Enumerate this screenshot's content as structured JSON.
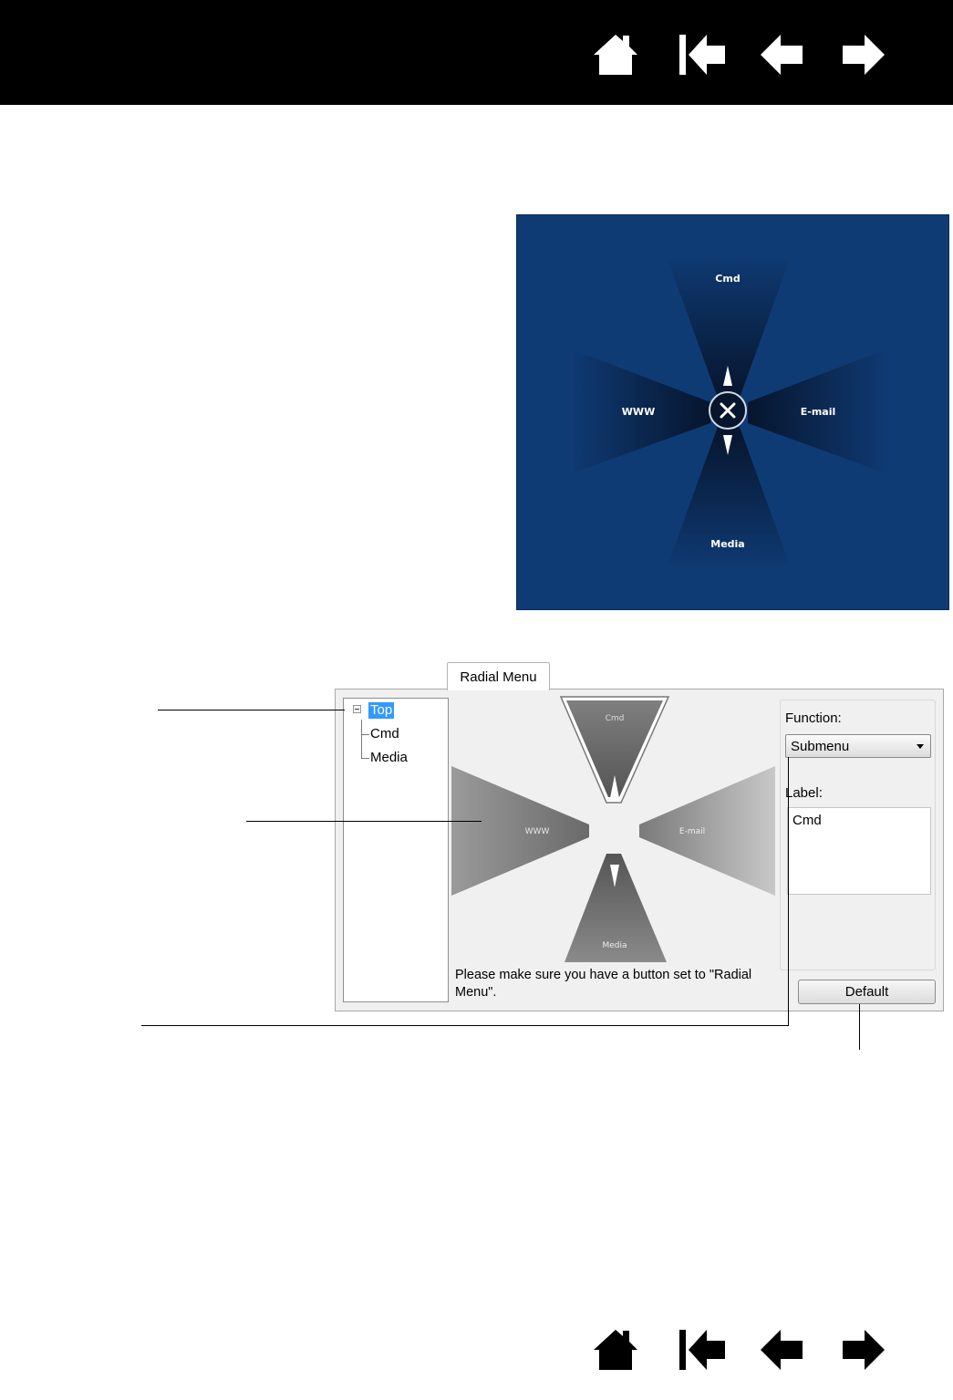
{
  "navigation": {
    "items": [
      {
        "name": "home-icon"
      },
      {
        "name": "first-page-icon"
      },
      {
        "name": "previous-page-icon"
      },
      {
        "name": "next-page-icon"
      }
    ]
  },
  "radial_popup": {
    "top_label": "Cmd",
    "left_label": "WWW",
    "right_label": "E-mail",
    "bottom_label": "Media",
    "background_color": "#0f3b75"
  },
  "control_panel": {
    "tab_label": "Radial Menu",
    "tree": {
      "root": "Top",
      "children": [
        "Cmd",
        "Media"
      ]
    },
    "preview": {
      "top_label": "Cmd",
      "left_label": "WWW",
      "right_label": "E-mail",
      "bottom_label": "Media"
    },
    "note": "Please make sure you have a button set to \"Radial Menu\".",
    "function_label": "Function:",
    "function_value": "Submenu",
    "label_label": "Label:",
    "label_value": "Cmd",
    "default_button": "Default"
  }
}
